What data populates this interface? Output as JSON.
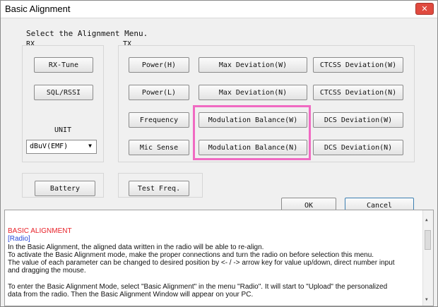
{
  "window": {
    "title": "Basic Alignment",
    "close_glyph": "✕"
  },
  "heading": "Select the Alignment Menu.",
  "rx": {
    "label": "RX",
    "buttons": [
      "RX-Tune",
      "SQL/RSSI"
    ],
    "unit_label": "UNIT",
    "unit_value": "dBuV(EMF)",
    "battery": "Battery"
  },
  "tx": {
    "label": "TX",
    "buttons": [
      [
        "Power(H)",
        "Max Deviation(W)",
        "CTCSS Deviation(W)"
      ],
      [
        "Power(L)",
        "Max Deviation(N)",
        "CTCSS Deviation(N)"
      ],
      [
        "Frequency",
        "Modulation Balance(W)",
        "DCS Deviation(W)"
      ],
      [
        "Mic Sense",
        "Modulation Balance(N)",
        "DCS Deviation(N)"
      ]
    ],
    "test_freq": "Test Freq."
  },
  "dialog": {
    "ok": "OK",
    "cancel": "Cancel"
  },
  "info": {
    "heading": "BASIC ALIGNMENT",
    "subheading": "[Radio]",
    "lines": [
      "In the Basic Alignment, the aligned data written in the radio will be able to re-align.",
      "To activate the Basic Alignment mode, make the proper connections and turn the radio on before selection this menu.",
      "The value of each parameter can be changed to desired position by <- / -> arrow key for value up/down, direct number input",
      "and dragging the mouse.",
      "",
      "To enter the Basic Alignment Mode, select \"Basic Alignment\" in the menu \"Radio\". It will start to \"Upload\" the personalized",
      "data from the radio. Then the Basic Alignment Window will appear on your PC."
    ]
  },
  "colors": {
    "info_heading": "#e8232a",
    "info_subheading": "#2a48d8",
    "highlight": "#f06ac2",
    "close_button": "#e04a3f"
  }
}
